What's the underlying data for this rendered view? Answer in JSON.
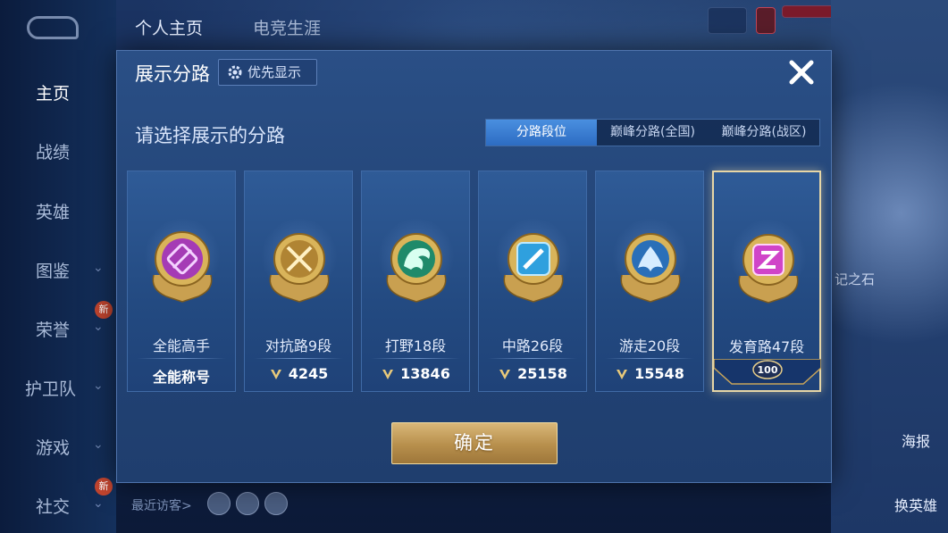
{
  "top_tabs": [
    "个人主页",
    "电竞生涯"
  ],
  "sidebar": {
    "items": [
      {
        "label": "主页",
        "active": true
      },
      {
        "label": "战绩"
      },
      {
        "label": "英雄"
      },
      {
        "label": "图鉴",
        "chevron": true
      },
      {
        "label": "荣誉",
        "chevron": true,
        "badge": "新"
      },
      {
        "label": "护卫队",
        "chevron": true
      },
      {
        "label": "游戏",
        "chevron": true
      },
      {
        "label": "社交",
        "chevron": true,
        "badge": "新"
      }
    ]
  },
  "right_panel": {
    "stone_label": "记之石",
    "poster_label": "海报",
    "swap_hero_label": "换英雄"
  },
  "visitors": {
    "label": "最近访客>"
  },
  "modal": {
    "title": "展示分路",
    "priority_label": "优先显示",
    "subtitle": "请选择展示的分路",
    "tabs": [
      "分路段位",
      "巅峰分路(全国)",
      "巅峰分路(战区)"
    ],
    "active_tab": 0,
    "cards": [
      {
        "name": "全能高手",
        "value": "全能称号",
        "emblem": "all-round-emblem",
        "color": "#c93fcf",
        "selected": false
      },
      {
        "name": "对抗路9段",
        "value": "4245",
        "emblem": "clash-lane-emblem",
        "color": "#d9a63a",
        "selected": false
      },
      {
        "name": "打野18段",
        "value": "13846",
        "emblem": "jungle-emblem",
        "color": "#2fae8c",
        "selected": false
      },
      {
        "name": "中路26段",
        "value": "25158",
        "emblem": "mid-lane-emblem",
        "color": "#3fb4e6",
        "selected": false
      },
      {
        "name": "游走20段",
        "value": "15548",
        "emblem": "roam-emblem",
        "color": "#3a8fd6",
        "selected": false
      },
      {
        "name": "发育路47段",
        "value": "",
        "emblem": "farm-lane-emblem",
        "color": "#d64fcf",
        "selected": true,
        "badge": "100"
      }
    ],
    "confirm_label": "确定"
  }
}
